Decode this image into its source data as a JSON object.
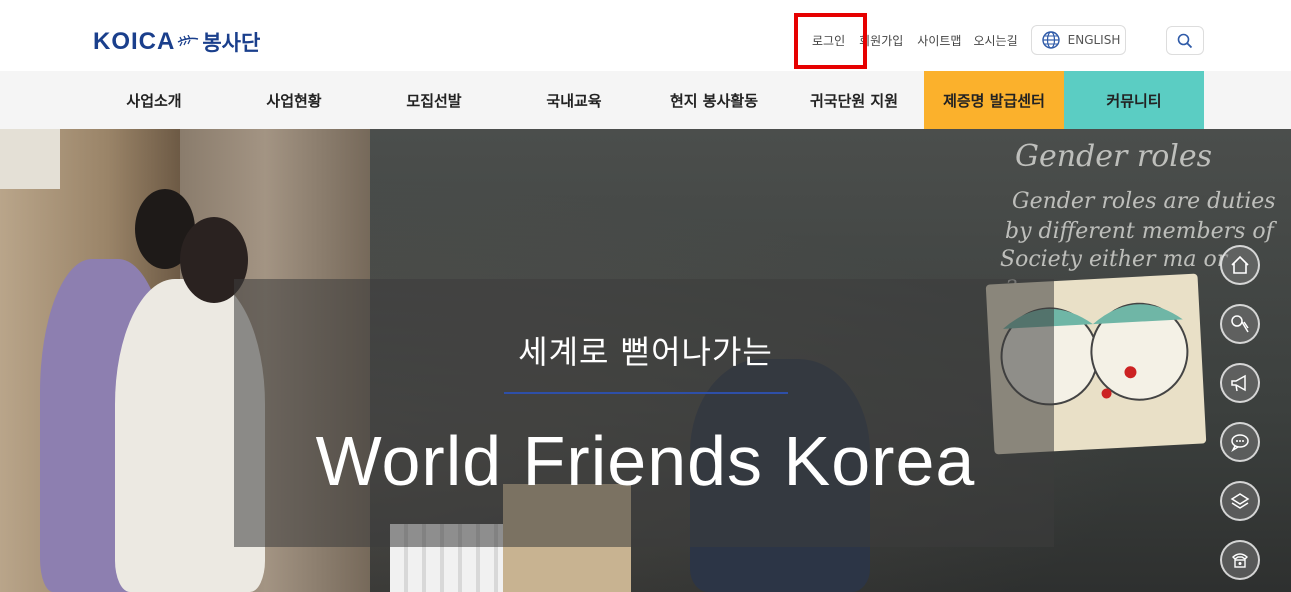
{
  "logo": {
    "brand": "KOICA",
    "name": "봉사단"
  },
  "utility": {
    "login": "로그인",
    "join": "회원가입",
    "sitemap": "사이트맵",
    "directions": "오시는길",
    "language": "ENGLISH"
  },
  "nav": {
    "items": [
      {
        "label": "사업소개"
      },
      {
        "label": "사업현황"
      },
      {
        "label": "모집선발"
      },
      {
        "label": "국내교육"
      },
      {
        "label": "현지 봉사활동"
      },
      {
        "label": "귀국단원 지원"
      },
      {
        "label": "제증명 발급센터"
      },
      {
        "label": "커뮤니티"
      }
    ],
    "colors": {
      "certificate": "#fbb12c",
      "community": "#5bcdc3"
    }
  },
  "hero": {
    "subtitle": "세계로 뻗어나가는",
    "title": "World Friends Korea",
    "chalkboard": [
      "Gender roles",
      "Gender roles are duties",
      "by different members of",
      "Society either ma or",
      "3ous c rea qua"
    ]
  },
  "quick_menu": {
    "icons": [
      "home-icon",
      "sports-icon",
      "megaphone-icon",
      "chat-icon",
      "layers-icon",
      "phone-icon"
    ]
  },
  "highlight_color": "#e60000",
  "brand_color": "#1a3f8c"
}
